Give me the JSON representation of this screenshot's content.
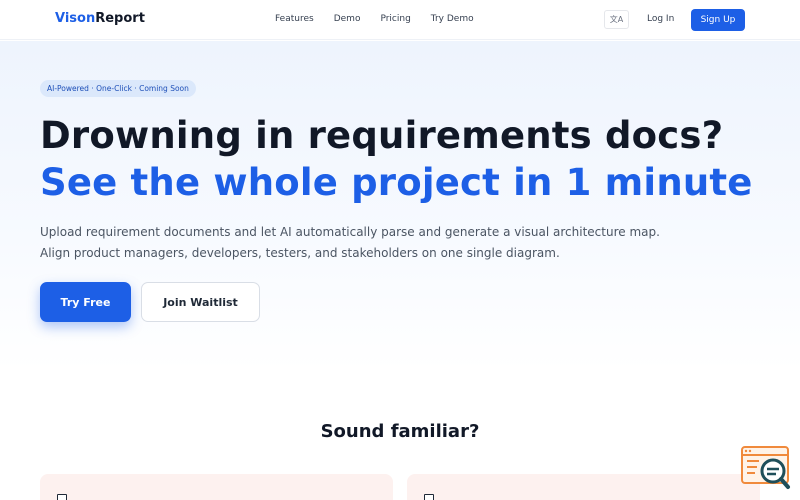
{
  "nav": {
    "logo_prefix": "Vison",
    "logo_suffix": "Report",
    "links": [
      "Features",
      "Demo",
      "Pricing",
      "Try Demo"
    ],
    "lang_label": "文A",
    "login": "Log In",
    "signup": "Sign Up"
  },
  "hero": {
    "badge": "AI-Powered · One-Click · Coming Soon",
    "headline": "Drowning in requirements docs?",
    "headline_accent": "See the whole project in 1 minute",
    "subtext_line1": "Upload requirement documents and let AI automatically parse and generate a visual architecture map.",
    "subtext_line2": "Align product managers, developers, testers, and stakeholders on one single diagram.",
    "primary_cta": "Try Free",
    "secondary_cta": "Join Waitlist"
  },
  "section": {
    "title": "Sound familiar?"
  },
  "colors": {
    "brand": "#1d5fe6",
    "badge_bg": "#dbe8fb",
    "card_bg": "#fdf1ef",
    "fab_accent": "#f08a3c",
    "fab_dark": "#1f4f5a"
  },
  "icons": {
    "language": "translate-icon",
    "widget": "search-window-icon",
    "card": "checkbox-icon"
  }
}
